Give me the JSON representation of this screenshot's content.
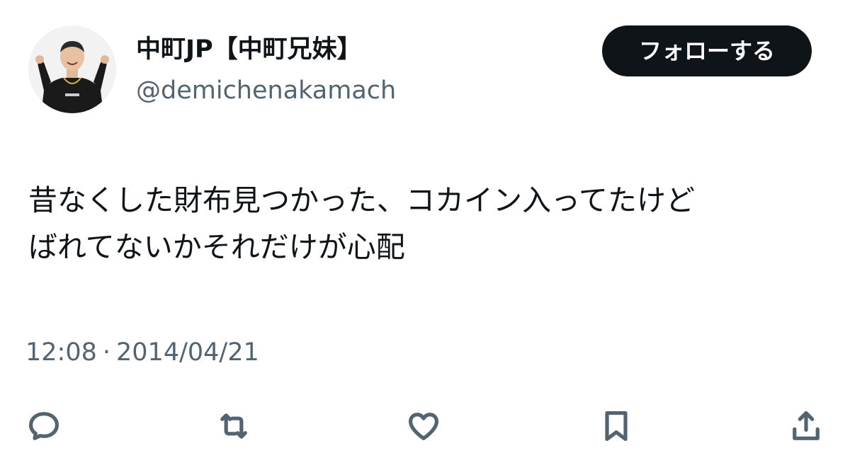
{
  "user": {
    "display_name": "中町JP【中町兄妹】",
    "handle": "@demichenakamach"
  },
  "follow_button": {
    "label": "フォローする"
  },
  "tweet": {
    "text_line1": "昔なくした財布見つかった、コカイン入ってたけど",
    "text_line2": "ばれてないかそれだけが心配",
    "time": "12:08",
    "separator": "·",
    "date": "2014/04/21"
  },
  "actions": [
    {
      "icon": "reply-icon"
    },
    {
      "icon": "retweet-icon"
    },
    {
      "icon": "like-icon"
    },
    {
      "icon": "bookmark-icon"
    },
    {
      "icon": "share-icon"
    }
  ],
  "colors": {
    "text": "#0f1419",
    "secondary": "#536471",
    "button_bg": "#0f1419",
    "button_text": "#ffffff"
  }
}
